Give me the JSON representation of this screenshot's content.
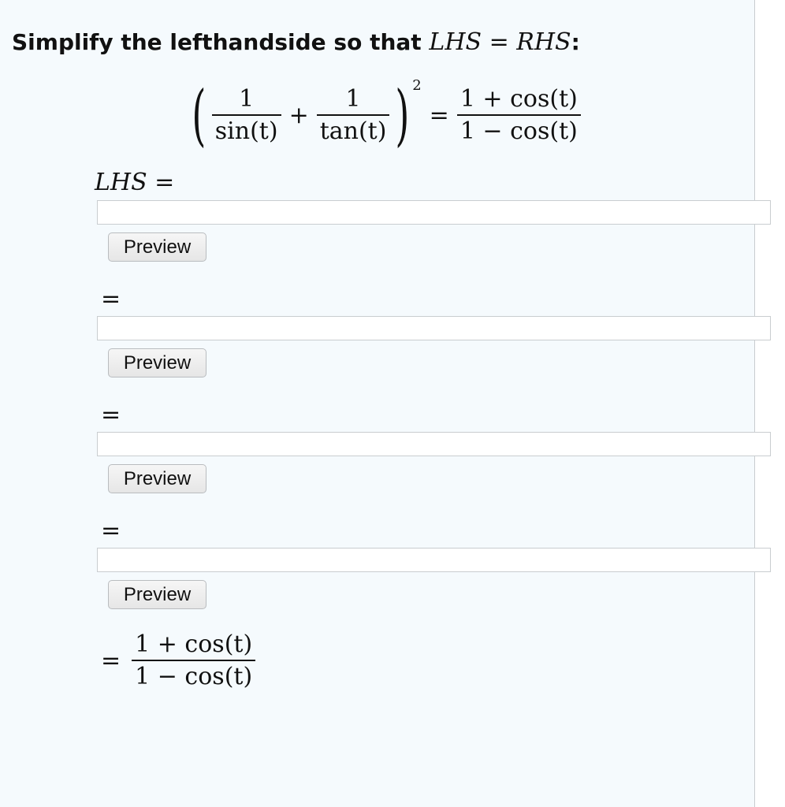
{
  "question": {
    "prefix": "Simplify the lefthandside so that ",
    "lhs": "LHS",
    "equals": "=",
    "rhs": "RHS",
    "suffix": ":"
  },
  "equation": {
    "term1_num": "1",
    "term1_den": "sin(t)",
    "plus": "+",
    "term2_num": "1",
    "term2_den": "tan(t)",
    "exponent": "2",
    "equals": "=",
    "rhs_num": "1 + cos(t)",
    "rhs_den": "1 − cos(t)",
    "open_paren": "(",
    "close_paren": ")"
  },
  "lhs_label": "LHS =",
  "equals_sign": "=",
  "steps": [
    {
      "value": "",
      "preview_label": "Preview"
    },
    {
      "value": "",
      "preview_label": "Preview"
    },
    {
      "value": "",
      "preview_label": "Preview"
    },
    {
      "value": "",
      "preview_label": "Preview"
    }
  ],
  "final": {
    "equals": "=",
    "num": "1 + cos(t)",
    "den": "1 − cos(t)"
  },
  "colors": {
    "panel_bg": "#f5fafd",
    "border": "#c9cdd0"
  }
}
